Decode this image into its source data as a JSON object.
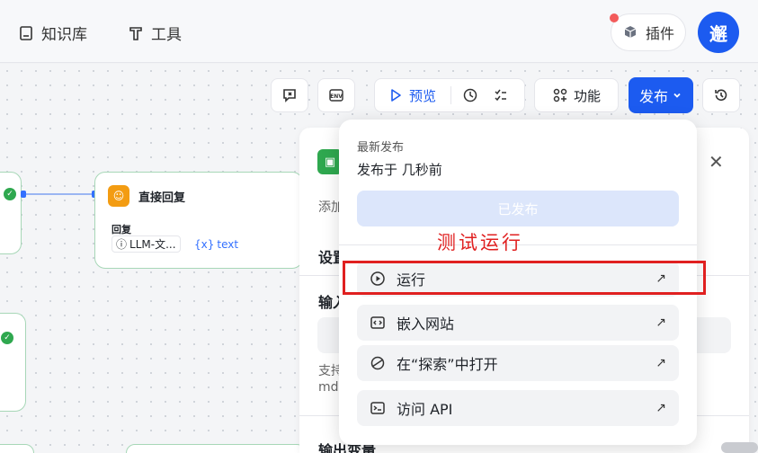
{
  "topbar": {
    "nav": [
      {
        "label": "知识库",
        "icon": "book-icon"
      },
      {
        "label": "工具",
        "icon": "tool-icon"
      }
    ],
    "plugin_label": "插件",
    "avatar_text": "邂"
  },
  "toolbar": {
    "preview_label": "预览",
    "feature_label": "功能",
    "publish_label": "发布"
  },
  "canvas": {
    "reply_node": {
      "title": "直接回复",
      "field_label": "回复",
      "tag_llm": "LLM-文...",
      "tag_var_prefix": "{x}",
      "tag_var": "text"
    }
  },
  "side_panel": {
    "add_text": "添加",
    "settings_text": "设置",
    "input_text": "输入",
    "support_text": "支持",
    "md_text": "md",
    "output_text": "输出变量"
  },
  "publish_menu": {
    "section_label": "最新发布",
    "published_time": "发布于 几秒前",
    "published_button": "已发布",
    "items": [
      {
        "label": "运行",
        "icon": "play-circle-icon"
      },
      {
        "label": "嵌入网站",
        "icon": "embed-icon"
      },
      {
        "label": "在“探索”中打开",
        "icon": "explore-icon"
      },
      {
        "label": "访问 API",
        "icon": "terminal-icon"
      }
    ]
  },
  "annotation": {
    "text": "测试运行"
  },
  "colors": {
    "primary": "#1c5bf0",
    "annotation": "#e02020",
    "success": "#2fa84f",
    "reply_icon": "#f39c12"
  }
}
